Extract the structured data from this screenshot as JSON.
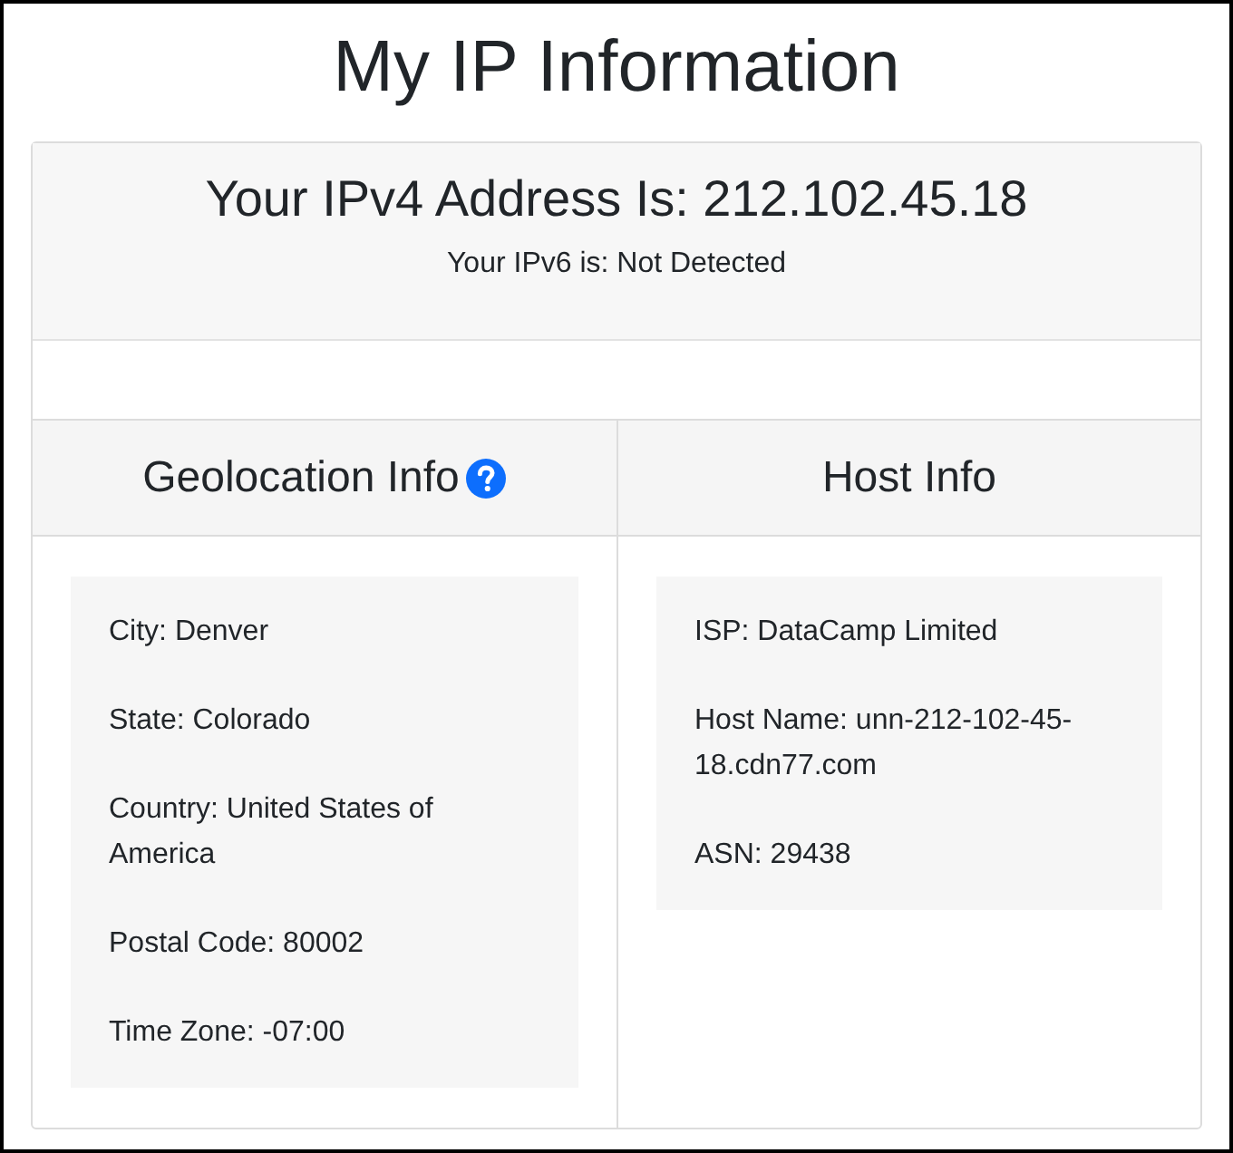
{
  "page_title": "My IP Information",
  "address": {
    "ipv4": "Your IPv4 Address Is: 212.102.45.18",
    "ipv6": "Your IPv6 is: Not Detected"
  },
  "columns": [
    {
      "title": "Geolocation Info",
      "help_icon": true,
      "items": [
        "City: Denver",
        "State: Colorado",
        "Country: United States of America",
        "Postal Code: 80002",
        "Time Zone: -07:00"
      ]
    },
    {
      "title": "Host Info",
      "help_icon": false,
      "items": [
        "ISP: DataCamp Limited",
        "Host Name: unn-212-102-45-18.cdn77.com",
        "ASN: 29438"
      ]
    }
  ]
}
